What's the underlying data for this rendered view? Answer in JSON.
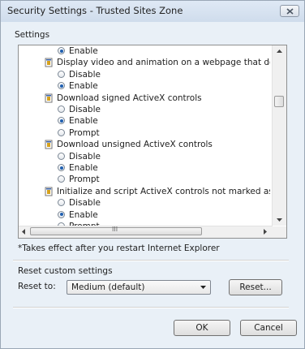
{
  "window": {
    "title": "Security Settings - Trusted Sites Zone"
  },
  "settings_label": "Settings",
  "tree": {
    "rows": [
      {
        "kind": "radio",
        "label": "Enable",
        "checked": true
      },
      {
        "kind": "setting",
        "label": "Display video and animation on a webpage that does not use"
      },
      {
        "kind": "radio",
        "label": "Disable",
        "checked": false
      },
      {
        "kind": "radio",
        "label": "Enable",
        "checked": true
      },
      {
        "kind": "setting",
        "label": "Download signed ActiveX controls"
      },
      {
        "kind": "radio",
        "label": "Disable",
        "checked": false
      },
      {
        "kind": "radio",
        "label": "Enable",
        "checked": true
      },
      {
        "kind": "radio",
        "label": "Prompt",
        "checked": false
      },
      {
        "kind": "setting",
        "label": "Download unsigned ActiveX controls"
      },
      {
        "kind": "radio",
        "label": "Disable",
        "checked": false
      },
      {
        "kind": "radio",
        "label": "Enable",
        "checked": true
      },
      {
        "kind": "radio",
        "label": "Prompt",
        "checked": false
      },
      {
        "kind": "setting",
        "label": "Initialize and script ActiveX controls not marked as safe for s"
      },
      {
        "kind": "radio",
        "label": "Disable",
        "checked": false
      },
      {
        "kind": "radio",
        "label": "Enable",
        "checked": true
      },
      {
        "kind": "radio",
        "label": "Prompt",
        "checked": false
      }
    ],
    "hscroll_grip": "III"
  },
  "note": "*Takes effect after you restart Internet Explorer",
  "reset_section": {
    "heading": "Reset custom settings",
    "reset_to_label": "Reset to:",
    "selected_level": "Medium (default)",
    "reset_button": "Reset..."
  },
  "footer": {
    "ok_button": "OK",
    "cancel_button": "Cancel"
  },
  "colors": {
    "radio_dot": "#1f5fb0",
    "title_bar": "#dfe9f5"
  }
}
